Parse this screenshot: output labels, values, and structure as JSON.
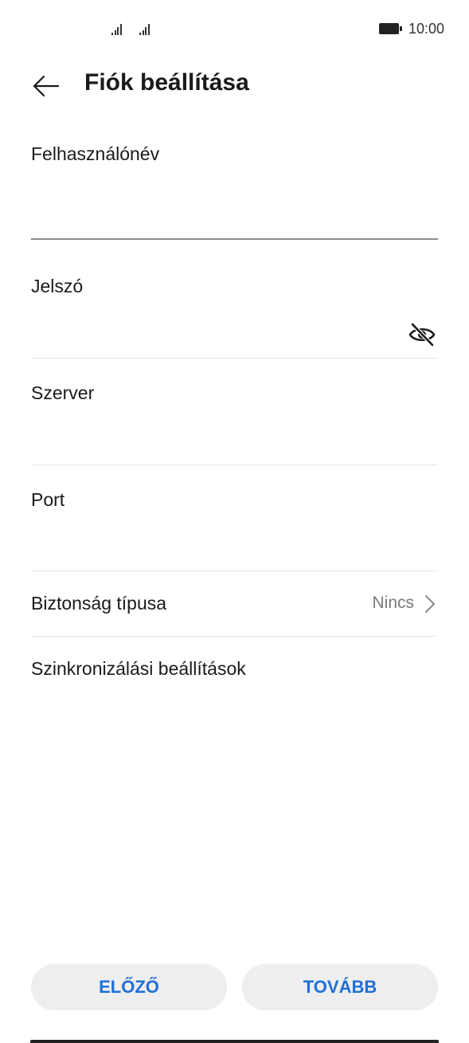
{
  "status_bar": {
    "time": "10:00",
    "icons": [
      "signal-icon",
      "signal-icon",
      "battery-icon"
    ]
  },
  "header": {
    "title": "Fiók beállítása",
    "back_icon": "back-arrow-icon"
  },
  "form": {
    "username": {
      "label": "Felhasználónév",
      "value": "",
      "placeholder": ""
    },
    "password": {
      "label": "Jelszó",
      "value": "",
      "placeholder": "",
      "visibility_icon": "eye-off-icon"
    },
    "server": {
      "label": "Szerver",
      "value": "",
      "placeholder": ""
    },
    "port": {
      "label": "Port",
      "value": "",
      "placeholder": ""
    },
    "security_type": {
      "label": "Biztonság típusa",
      "value": "Nincs",
      "icon": "chevron-right-icon"
    },
    "sync_settings": {
      "label": "Szinkronizálási beállítások"
    }
  },
  "buttons": {
    "previous": "ELŐZŐ",
    "next": "TOVÁBB"
  },
  "colors": {
    "accent": "#1f6fd6",
    "button_bg": "#eeeeee",
    "divider": "#e6e6e6",
    "secondary_text": "#7a7a7a"
  }
}
